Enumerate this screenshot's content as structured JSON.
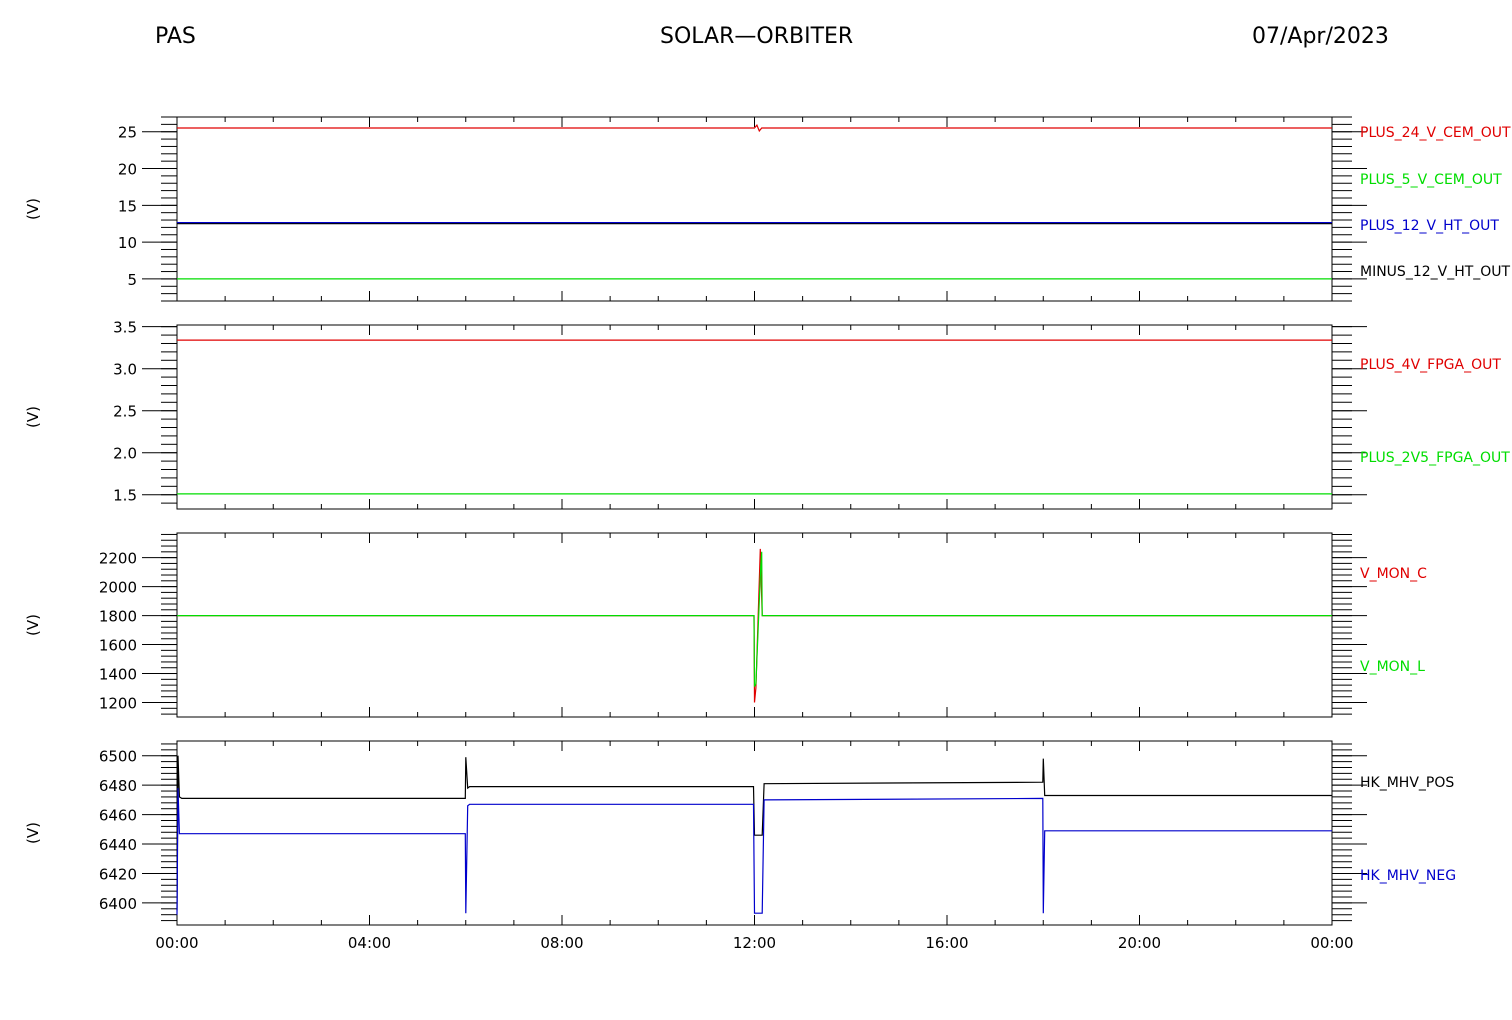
{
  "header": {
    "left": "PAS",
    "center": "SOLAR—ORBITER",
    "right": "07/Apr/2023"
  },
  "chart_data": [
    {
      "type": "line",
      "ylabel": "(V)",
      "ylim": [
        2,
        27
      ],
      "yticks": [
        5,
        10,
        15,
        20,
        25
      ],
      "ytick_labels": [
        "5",
        "10",
        "15",
        "20",
        "25"
      ],
      "x_ticks": [
        "00:00",
        "04:00",
        "08:00",
        "12:00",
        "16:00",
        "20:00",
        "00:00"
      ],
      "series": [
        {
          "name": "PLUS_24_V_CEM_OUT",
          "color": "#e00000",
          "x": [
            0,
            12.0,
            12.05,
            12.1,
            12.15,
            24
          ],
          "y": [
            25.5,
            25.5,
            25.9,
            25.1,
            25.5,
            25.5
          ]
        },
        {
          "name": "PLUS_5_V_CEM_OUT",
          "color": "#00dd00",
          "x": [
            0,
            24
          ],
          "y": [
            5.0,
            5.0
          ]
        },
        {
          "name": "PLUS_12_V_HT_OUT",
          "color": "#0000cc",
          "x": [
            0,
            24
          ],
          "y": [
            12.6,
            12.6
          ]
        },
        {
          "name": "MINUS_12_V_HT_OUT",
          "color": "#000000",
          "x": [
            0,
            24
          ],
          "y": [
            12.5,
            12.5
          ]
        }
      ]
    },
    {
      "type": "line",
      "ylabel": "(V)",
      "ylim": [
        1.33,
        3.52
      ],
      "yticks": [
        1.5,
        2.0,
        2.5,
        3.0,
        3.5
      ],
      "ytick_labels": [
        "1.5",
        "2.0",
        "2.5",
        "3.0",
        "3.5"
      ],
      "series": [
        {
          "name": "PLUS_4V_FPGA_OUT",
          "color": "#e00000",
          "x": [
            0,
            24
          ],
          "y": [
            3.34,
            3.34
          ]
        },
        {
          "name": "PLUS_2V5_FPGA_OUT",
          "color": "#00dd00",
          "x": [
            0,
            24
          ],
          "y": [
            1.51,
            1.51
          ]
        }
      ]
    },
    {
      "type": "line",
      "ylabel": "(V)",
      "ylim": [
        1100,
        2370
      ],
      "yticks": [
        1200,
        1400,
        1600,
        1800,
        2000,
        2200
      ],
      "ytick_labels": [
        "1200",
        "1400",
        "1600",
        "1800",
        "2000",
        "2200"
      ],
      "series": [
        {
          "name": "V_MON_C",
          "color": "#e00000",
          "x": [
            0,
            11.99,
            12.0,
            12.03,
            12.12,
            12.16,
            24
          ],
          "y": [
            1800,
            1800,
            1200,
            1300,
            2260,
            1800,
            1800
          ]
        },
        {
          "name": "V_MON_L",
          "color": "#00dd00",
          "x": [
            0,
            11.99,
            12.0,
            12.03,
            12.13,
            12.15,
            12.16,
            24
          ],
          "y": [
            1800,
            1800,
            1310,
            1330,
            2150,
            2240,
            1800,
            1800
          ]
        }
      ]
    },
    {
      "type": "line",
      "ylabel": "(V)",
      "ylim": [
        6385,
        6510
      ],
      "yticks": [
        6400,
        6420,
        6440,
        6460,
        6480,
        6500
      ],
      "ytick_labels": [
        "6400",
        "6420",
        "6440",
        "6460",
        "6480",
        "6500"
      ],
      "series": [
        {
          "name": "HK_MHV_POS",
          "color": "#000000",
          "x": [
            0,
            0.02,
            0.05,
            0.1,
            5.99,
            6.0,
            6.04,
            6.08,
            11.98,
            12.0,
            12.16,
            12.2,
            17.99,
            18.0,
            18.03,
            24
          ],
          "y": [
            6395,
            6500,
            6472,
            6471,
            6471,
            6499,
            6478,
            6479,
            6479,
            6446,
            6446,
            6481,
            6482,
            6498,
            6473,
            6473
          ]
        },
        {
          "name": "HK_MHV_NEG",
          "color": "#0000cc",
          "x": [
            0,
            0.02,
            0.05,
            0.1,
            5.99,
            6.0,
            6.04,
            6.08,
            11.98,
            12.0,
            12.16,
            12.2,
            17.99,
            18.0,
            18.03,
            24
          ],
          "y": [
            6392,
            6478,
            6447,
            6447,
            6447,
            6393,
            6466,
            6467,
            6467,
            6393,
            6393,
            6470,
            6471,
            6393,
            6449,
            6449
          ]
        }
      ]
    }
  ]
}
